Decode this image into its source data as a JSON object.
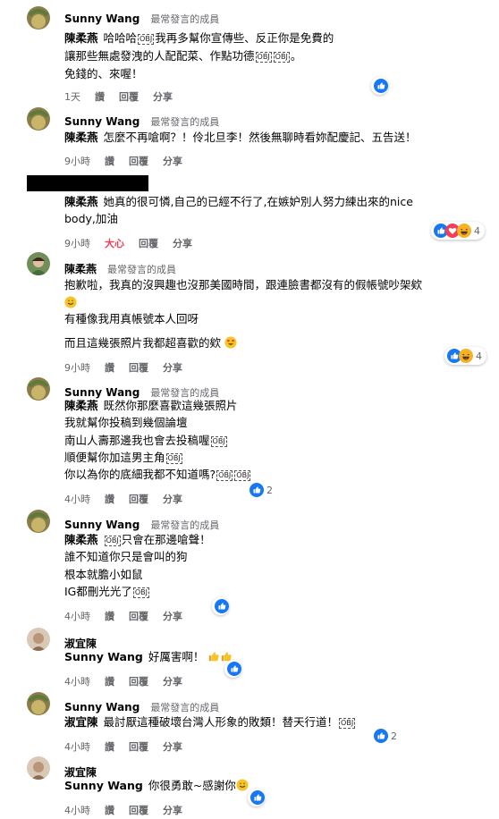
{
  "colors": {
    "like_blue": "#1877f2",
    "heart_red": "#f33e58",
    "meta_gray": "#65676b"
  },
  "comments": [
    {
      "author": "Sunny Wang",
      "badge": "最常發言的成員",
      "mention": "陳柔燕",
      "lines": [
        "哈哈哈",
        "我再多幫你宣傳些、反正你是免費的",
        "讓那些無處發洩的人配配菜、作點功德",
        "。",
        "免錢的、來喔！"
      ],
      "time": "1天",
      "like": "讚",
      "reply": "回覆",
      "share": "分享",
      "reactions": [
        "like-icon"
      ],
      "reaction_count": ""
    },
    {
      "author": "Sunny Wang",
      "badge": "最常發言的成員",
      "mention": "陳柔燕",
      "lines": [
        "怎麼不再嗆啊？！伶北旦李！然後無聊時看妳配慶記、五告送！"
      ],
      "time": "9小時",
      "like": "讚",
      "reply": "回覆",
      "share": "分享"
    },
    {
      "author": "",
      "mention": "陳柔燕",
      "lines": [
        "她真的很可憐,自己的已經不行了,在嫉妒別人努力練出來的nice",
        "body,加油"
      ],
      "time": "9小時",
      "like": "大心",
      "reply": "回覆",
      "share": "分享",
      "reactions": [
        "like-icon",
        "heart-icon",
        "laugh-icon"
      ],
      "reaction_count": "4"
    },
    {
      "author": "陳柔燕",
      "badge": "最常發言的成員",
      "lines": [
        "抱歉啦，我真的沒興趣也沒那美國時間，跟連臉書都沒有的假帳號吵架欸",
        "有種像我用真帳號本人回呀",
        "而且這幾張照片我都超喜歡的欸"
      ],
      "time": "9小時",
      "like": "讚",
      "reply": "回覆",
      "share": "分享",
      "reactions": [
        "like-icon",
        "laugh-icon"
      ],
      "reaction_count": "4"
    },
    {
      "author": "Sunny Wang",
      "badge": "最常發言的成員",
      "mention": "陳柔燕",
      "lines": [
        "既然你那麼喜歡這幾張照片",
        "我就幫你投稿到幾個論壇",
        "南山人壽那邊我也會去投稿喔",
        "順便幫你加這男主角",
        "你以為你的底細我都不知道嗎?"
      ],
      "time": "4小時",
      "like": "讚",
      "reply": "回覆",
      "share": "分享",
      "reactions": [
        "like-icon"
      ],
      "reaction_count": "2"
    },
    {
      "author": "Sunny Wang",
      "badge": "最常發言的成員",
      "mention": "陳柔燕",
      "lines": [
        "只會在那邊嗆聲！",
        "誰不知道你只是會叫的狗",
        "根本就膽小如鼠",
        "IG都刪光光了"
      ],
      "time": "4小時",
      "like": "讚",
      "reply": "回覆",
      "share": "分享",
      "reactions": [
        "like-icon"
      ],
      "reaction_count": ""
    },
    {
      "author": "淑宜陳",
      "mention": "Sunny Wang",
      "lines": [
        "好厲害啊！"
      ],
      "time": "4小時",
      "like": "讚",
      "reply": "回覆",
      "share": "分享",
      "reactions": [
        "like-icon"
      ],
      "reaction_count": ""
    },
    {
      "author": "Sunny Wang",
      "badge": "最常發言的成員",
      "mention": "淑宜陳",
      "lines": [
        "最討厭這種破壞台灣人形象的敗類！替天行道！"
      ],
      "time": "4小時",
      "like": "讚",
      "reply": "回覆",
      "share": "分享",
      "reactions": [
        "like-icon"
      ],
      "reaction_count": "2"
    },
    {
      "author": "淑宜陳",
      "mention": "Sunny Wang",
      "lines": [
        "你很勇敢~感謝你"
      ],
      "time": "4小時",
      "like": "讚",
      "reply": "回覆",
      "share": "分享",
      "reactions": [
        "like-icon"
      ],
      "reaction_count": ""
    }
  ],
  "obscured_mark": "OBJ"
}
